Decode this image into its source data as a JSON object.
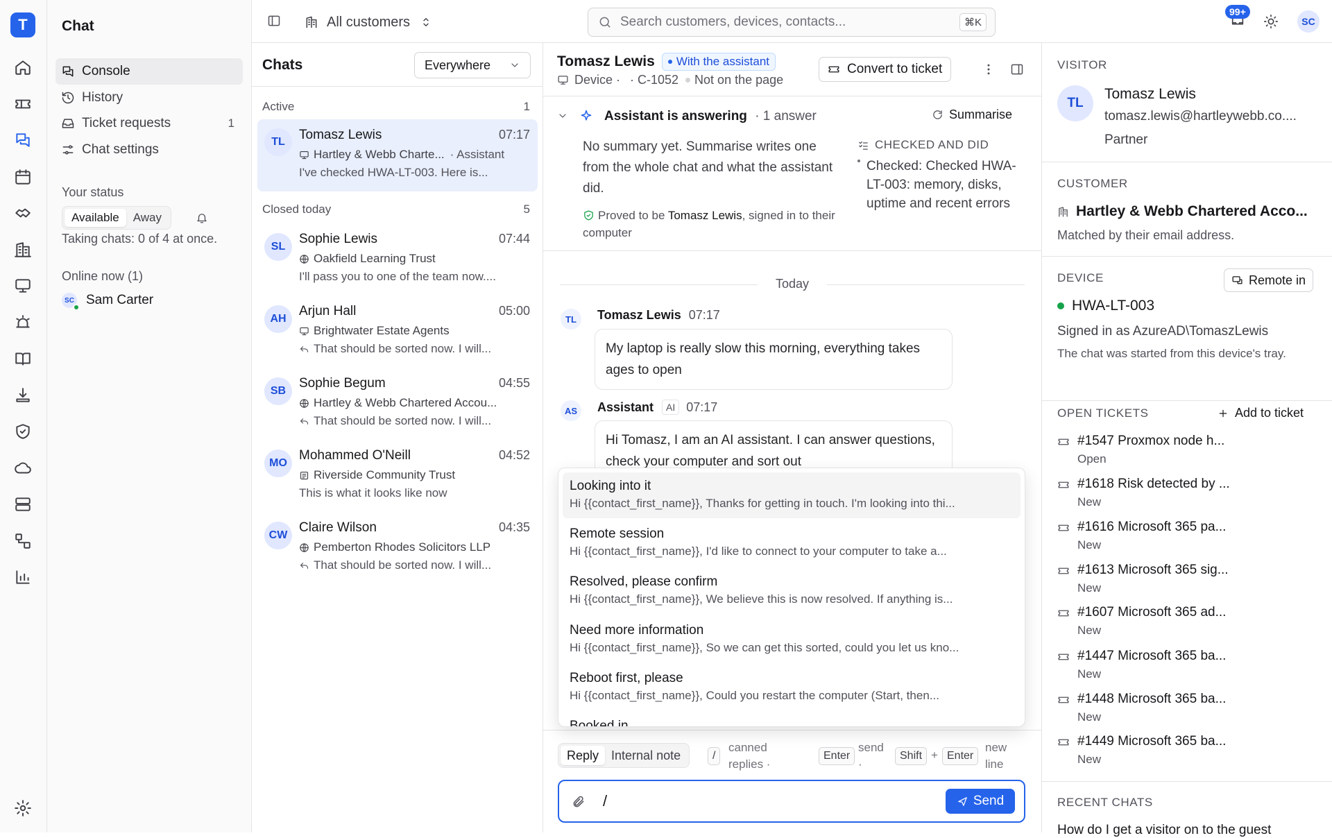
{
  "app": {
    "logo": "T",
    "section_title": "Chat"
  },
  "colors": {
    "accent": "#2563eb",
    "online": "#16a34a",
    "badge_bg": "#eff6ff"
  },
  "rail": {
    "items": [
      "home-icon",
      "ticket-icon",
      "chat-icon",
      "calendar-icon",
      "handshake-icon",
      "building-icon",
      "monitor-icon",
      "alarm-icon",
      "book-icon",
      "download-icon",
      "shield-icon",
      "cloud-icon",
      "server-icon",
      "network-icon",
      "chart-icon"
    ],
    "settings_icon": "gear-icon"
  },
  "nav": {
    "items": [
      {
        "label": "Console",
        "icon": "chat-icon",
        "active": true
      },
      {
        "label": "History",
        "icon": "history-icon"
      },
      {
        "label": "Ticket requests",
        "icon": "inbox-icon",
        "count": "1"
      },
      {
        "label": "Chat settings",
        "icon": "sliders-icon"
      }
    ],
    "status_heading": "Your status",
    "status_options": [
      "Available",
      "Away"
    ],
    "status_selected": "Available",
    "taking_chats": "Taking chats: 0 of 4 at once.",
    "online_heading": "Online now (1)",
    "online_user": {
      "initials": "SC",
      "name": "Sam Carter"
    }
  },
  "topbar": {
    "scope": "All customers",
    "search_placeholder": "Search customers, devices, contacts...",
    "search_shortcut": "⌘K",
    "notifications_badge": "99+",
    "user_initials": "SC"
  },
  "chats": {
    "title": "Chats",
    "filter": "Everywhere",
    "active_label": "Active",
    "active_count": "1",
    "closed_label": "Closed today",
    "closed_count": "5",
    "active": [
      {
        "initials": "TL",
        "name": "Tomasz Lewis",
        "time": "07:17",
        "org": "Hartley & Webb Charte...",
        "org_icon": "monitor-icon",
        "tag": "· Assistant",
        "preview": "I've checked HWA-LT-003. Here is..."
      }
    ],
    "closed": [
      {
        "initials": "SL",
        "name": "Sophie Lewis",
        "time": "07:44",
        "org": "Oakfield Learning Trust",
        "org_icon": "globe-icon",
        "preview": "I'll pass you to one of the team now...."
      },
      {
        "initials": "AH",
        "name": "Arjun Hall",
        "time": "05:00",
        "org": "Brightwater Estate Agents",
        "org_icon": "monitor-icon",
        "preview": "That should be sorted now. I will..."
      },
      {
        "initials": "SB",
        "name": "Sophie Begum",
        "time": "04:55",
        "org": "Hartley & Webb Chartered Accou...",
        "org_icon": "globe-icon",
        "preview": "That should be sorted now. I will..."
      },
      {
        "initials": "MO",
        "name": "Mohammed O'Neill",
        "time": "04:52",
        "org": "Riverside Community Trust",
        "org_icon": "form-icon",
        "preview": "This is what it looks like now"
      },
      {
        "initials": "CW",
        "name": "Claire Wilson",
        "time": "04:35",
        "org": "Pemberton Rhodes Solicitors LLP",
        "org_icon": "globe-icon",
        "preview": "That should be sorted now. I will..."
      }
    ]
  },
  "conversation": {
    "name": "Tomasz Lewis",
    "badge": "With the assistant",
    "meta_device": "Device ·",
    "meta_id": "· C-1052",
    "meta_page": "Not on the page",
    "convert_button": "Convert to ticket",
    "assistant_status": "Assistant is answering",
    "assistant_count": "· 1 answer",
    "summarise": "Summarise",
    "summary_text": "No summary yet. Summarise writes one from the whole chat and what the assistant did.",
    "proved_prefix": "Proved to be ",
    "proved_name": "Tomasz Lewis",
    "proved_suffix": ", signed in to their computer",
    "checked_heading": "CHECKED AND DID",
    "checked_item": "Checked: Checked HWA-LT-003: memory, disks, uptime and recent errors",
    "day_divider": "Today",
    "messages": [
      {
        "initials": "TL",
        "author": "Tomasz Lewis",
        "time": "07:17",
        "text": "My laptop is really slow this morning, everything takes ages to open"
      },
      {
        "initials": "AS",
        "author": "Assistant",
        "tag": "AI",
        "time": "07:17",
        "text": "Hi Tomasz, I am an AI assistant. I can answer questions, check your computer and sort out"
      }
    ],
    "canned_replies": [
      {
        "title": "Looking into it",
        "body": "Hi {{contact_first_name}}, Thanks for getting in touch. I'm looking into thi..."
      },
      {
        "title": "Remote session",
        "body": "Hi {{contact_first_name}}, I'd like to connect to your computer to take a..."
      },
      {
        "title": "Resolved, please confirm",
        "body": "Hi {{contact_first_name}}, We believe this is now resolved. If anything is..."
      },
      {
        "title": "Need more information",
        "body": "Hi {{contact_first_name}}, So we can get this sorted, could you let us kno..."
      },
      {
        "title": "Reboot first, please",
        "body": "Hi {{contact_first_name}}, Could you restart the computer (Start, then..."
      },
      {
        "title": "Booked in",
        "body": ""
      }
    ],
    "composer": {
      "tabs": [
        "Reply",
        "Internal note"
      ],
      "hint_slash": "/",
      "hint_canned": "canned replies ·",
      "hint_enter": "Enter",
      "hint_send": "send ·",
      "hint_shift": "Shift",
      "hint_plus": "+",
      "hint_newline": "new line",
      "input_value": "/",
      "send_label": "Send"
    }
  },
  "visitor": {
    "heading": "VISITOR",
    "initials": "TL",
    "name": "Tomasz Lewis",
    "email": "tomasz.lewis@hartleywebb.co....",
    "role": "Partner"
  },
  "customer": {
    "heading": "CUSTOMER",
    "name": "Hartley & Webb Chartered Acco...",
    "note": "Matched by their email address."
  },
  "device": {
    "heading": "DEVICE",
    "remote_button": "Remote in",
    "name": "HWA-LT-003",
    "signed_in": "Signed in as AzureAD\\TomaszLewis",
    "note": "The chat was started from this device's tray."
  },
  "tickets": {
    "heading": "OPEN TICKETS",
    "add_button": "Add to ticket",
    "items": [
      {
        "title": "#1547 Proxmox node h...",
        "status": "Open"
      },
      {
        "title": "#1618 Risk detected by ...",
        "status": "New"
      },
      {
        "title": "#1616 Microsoft 365 pa...",
        "status": "New"
      },
      {
        "title": "#1613 Microsoft 365 sig...",
        "status": "New"
      },
      {
        "title": "#1607 Microsoft 365 ad...",
        "status": "New"
      },
      {
        "title": "#1447 Microsoft 365 ba...",
        "status": "New"
      },
      {
        "title": "#1448 Microsoft 365 ba...",
        "status": "New"
      },
      {
        "title": "#1449 Microsoft 365 ba...",
        "status": "New"
      }
    ]
  },
  "recent": {
    "heading": "RECENT CHATS",
    "first": "How do I get a visitor on to the guest"
  }
}
